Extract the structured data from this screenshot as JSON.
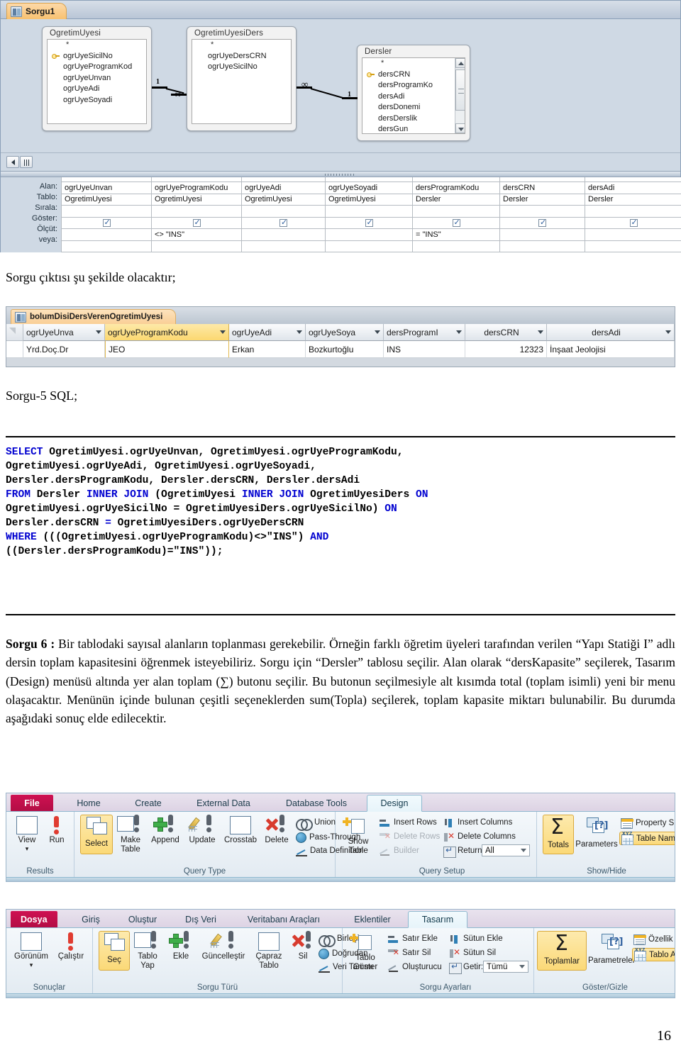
{
  "query_design": {
    "tab_label": "Sorgu1",
    "tables": [
      {
        "name": "OgretimUyesi",
        "fields": [
          "*",
          "ogrUyeSicilNo",
          "ogrUyeProgramKod",
          "ogrUyeUnvan",
          "ogrUyeAdi",
          "ogrUyeSoyadi"
        ],
        "key_field": "ogrUyeSicilNo"
      },
      {
        "name": "OgretimUyesiDers",
        "fields": [
          "*",
          "ogrUyeDersCRN",
          "ogrUyeSicilNo"
        ],
        "key_field": ""
      },
      {
        "name": "Dersler",
        "fields": [
          "*",
          "dersCRN",
          "dersProgramKo",
          "dersAdi",
          "dersDonemi",
          "dersDerslik",
          "dersGun"
        ],
        "key_field": "dersCRN"
      }
    ],
    "join_labels": [
      "1",
      "∞",
      "∞",
      "1"
    ],
    "grid": {
      "row_labels": [
        "Alan:",
        "Tablo:",
        "Sırala:",
        "Göster:",
        "Ölçüt:",
        "veya:"
      ],
      "columns": [
        {
          "alan": "ogrUyeUnvan",
          "tablo": "OgretimUyesi",
          "sirala": "",
          "goster": true,
          "olcut": "",
          "veya": ""
        },
        {
          "alan": "ogrUyeProgramKodu",
          "tablo": "OgretimUyesi",
          "sirala": "",
          "goster": true,
          "olcut": "<> \"INS\"",
          "veya": ""
        },
        {
          "alan": "ogrUyeAdi",
          "tablo": "OgretimUyesi",
          "sirala": "",
          "goster": true,
          "olcut": "",
          "veya": ""
        },
        {
          "alan": "ogrUyeSoyadi",
          "tablo": "OgretimUyesi",
          "sirala": "",
          "goster": true,
          "olcut": "",
          "veya": ""
        },
        {
          "alan": "dersProgramKodu",
          "tablo": "Dersler",
          "sirala": "",
          "goster": true,
          "olcut": "= \"INS\"",
          "veya": ""
        },
        {
          "alan": "dersCRN",
          "tablo": "Dersler",
          "sirala": "",
          "goster": true,
          "olcut": "",
          "veya": ""
        },
        {
          "alan": "dersAdi",
          "tablo": "Dersler",
          "sirala": "",
          "goster": true,
          "olcut": "",
          "veya": ""
        }
      ]
    }
  },
  "caption_output": "Sorgu çıktısı şu şekilde olacaktır;",
  "datasheet": {
    "tab_label": "bolumDisiDersVerenOgretimUyesi",
    "headers": [
      "ogrUyeUnva",
      "ogrUyeProgramKodu",
      "ogrUyeAdi",
      "ogrUyeSoya",
      "dersProgramI",
      "dersCRN",
      "dersAdi"
    ],
    "selected_column": "ogrUyeProgramKodu",
    "rows": [
      [
        "Yrd.Doç.Dr",
        "JEO",
        "Erkan",
        "Bozkurtoğlu",
        "INS",
        "12323",
        "İnşaat Jeolojisi"
      ]
    ]
  },
  "caption_sql": "Sorgu-5 SQL;",
  "sql": {
    "lines": [
      [
        {
          "t": "SELECT",
          "k": true
        },
        {
          "t": " OgretimUyesi.ogrUyeUnvan, OgretimUyesi.ogrUyeProgramKodu,",
          "k": false
        }
      ],
      [
        {
          "t": "OgretimUyesi.ogrUyeAdi, OgretimUyesi.ogrUyeSoyadi,",
          "k": false
        }
      ],
      [
        {
          "t": "Dersler.dersProgramKodu, Dersler.dersCRN, Dersler.dersAdi",
          "k": false
        }
      ],
      [
        {
          "t": "FROM",
          "k": true
        },
        {
          "t": " Dersler ",
          "k": false
        },
        {
          "t": "INNER JOIN",
          "k": true
        },
        {
          "t": " (OgretimUyesi ",
          "k": false
        },
        {
          "t": "INNER JOIN",
          "k": true
        },
        {
          "t": " OgretimUyesiDers ",
          "k": false
        },
        {
          "t": "ON",
          "k": true
        }
      ],
      [
        {
          "t": "OgretimUyesi.ogrUyeSicilNo = OgretimUyesiDers.ogrUyeSicilNo) ",
          "k": false
        },
        {
          "t": "ON",
          "k": true
        }
      ],
      [
        {
          "t": "Dersler.dersCRN ",
          "k": false
        },
        {
          "t": "=",
          "k": true
        },
        {
          "t": " OgretimUyesiDers.ogrUyeDersCRN",
          "k": false
        }
      ],
      [
        {
          "t": "WHERE",
          "k": true
        },
        {
          "t": " (((OgretimUyesi.ogrUyeProgramKodu)<>\"INS\") ",
          "k": false
        },
        {
          "t": "AND",
          "k": true
        }
      ],
      [
        {
          "t": "((Dersler.dersProgramKodu)=\"INS\"));",
          "k": false
        }
      ]
    ]
  },
  "paragraph": {
    "lead": "Sorgu 6 : ",
    "body": "Bir tablodaki sayısal alanların toplanması gerekebilir. Örneğin farklı öğretim üyeleri tarafından verilen “Yapı Statiği I” adlı dersin toplam kapasitesini öğrenmek isteyebiliriz. Sorgu için “Dersler” tablosu seçilir. Alan olarak “dersKapasite” seçilerek, Tasarım (Design) menüsü altında yer alan toplam (∑) butonu seçilir. Bu butonun seçilmesiyle alt kısımda total (toplam isimli) yeni bir menu olaşacaktır. Menünün içinde bulunan çeşitli seçeneklerden sum(Topla) seçilerek, toplam kapasite miktarı bulunabilir. Bu durumda aşağıdaki sonuç elde edilecektir."
  },
  "ribbon_en": {
    "file_tab": "File",
    "tabs": [
      "Home",
      "Create",
      "External Data",
      "Database Tools",
      "Design"
    ],
    "active_tab": "Design",
    "groups": [
      {
        "name": "Results",
        "buttons": [
          "View",
          "Run"
        ]
      },
      {
        "name": "Query Type",
        "buttons": [
          "Select",
          "Make Table",
          "Append",
          "Update",
          "Crosstab",
          "Delete"
        ],
        "highlighted": "Select",
        "small_items": [
          "Union",
          "Pass-Through",
          "Data Definition"
        ]
      },
      {
        "name": "Query Setup",
        "buttons": [
          "Show Table"
        ],
        "small_items": [
          "Insert Rows",
          "Delete Rows",
          "Builder",
          "Insert Columns",
          "Delete Columns",
          "Return:"
        ],
        "disabled_items": [
          "Delete Rows",
          "Builder"
        ],
        "return_value": "All"
      },
      {
        "name": "Show/Hide",
        "buttons": [
          "Totals",
          "Parameters"
        ],
        "highlighted": "Totals",
        "small_items": [
          "Property Sheet",
          "Table Names"
        ],
        "highlighted_small": "Table Names"
      }
    ],
    "sigma_glyph": "Σ"
  },
  "ribbon_tr": {
    "file_tab": "Dosya",
    "tabs": [
      "Giriş",
      "Oluştur",
      "Dış Veri",
      "Veritabanı Araçları",
      "Eklentiler",
      "Tasarım"
    ],
    "active_tab": "Tasarım",
    "groups": [
      {
        "name": "Sonuçlar",
        "buttons": [
          "Görünüm",
          "Çalıştır"
        ]
      },
      {
        "name": "Sorgu Türü",
        "buttons": [
          "Seç",
          "Tablo Yap",
          "Ekle",
          "Güncelleştir",
          "Çapraz Tablo",
          "Sil"
        ],
        "highlighted": "Seç",
        "small_items": [
          "Birleşim",
          "Doğrudan",
          "Veri Tanımı"
        ]
      },
      {
        "name": "Sorgu Ayarları",
        "buttons": [
          "Tablo Göster"
        ],
        "small_items": [
          "Satır Ekle",
          "Satır Sil",
          "Oluşturucu",
          "Sütun Ekle",
          "Sütun Sil",
          "Getir:"
        ],
        "return_value": "Tümü"
      },
      {
        "name": "Göster/Gizle",
        "buttons": [
          "Toplamlar",
          "Parametreler"
        ],
        "highlighted": "Toplamlar",
        "small_items": [
          "Özellik Sayfası",
          "Tablo Adları"
        ],
        "highlighted_small": "Tablo Adları"
      }
    ],
    "sigma_glyph": "Σ"
  },
  "page_number": "16"
}
